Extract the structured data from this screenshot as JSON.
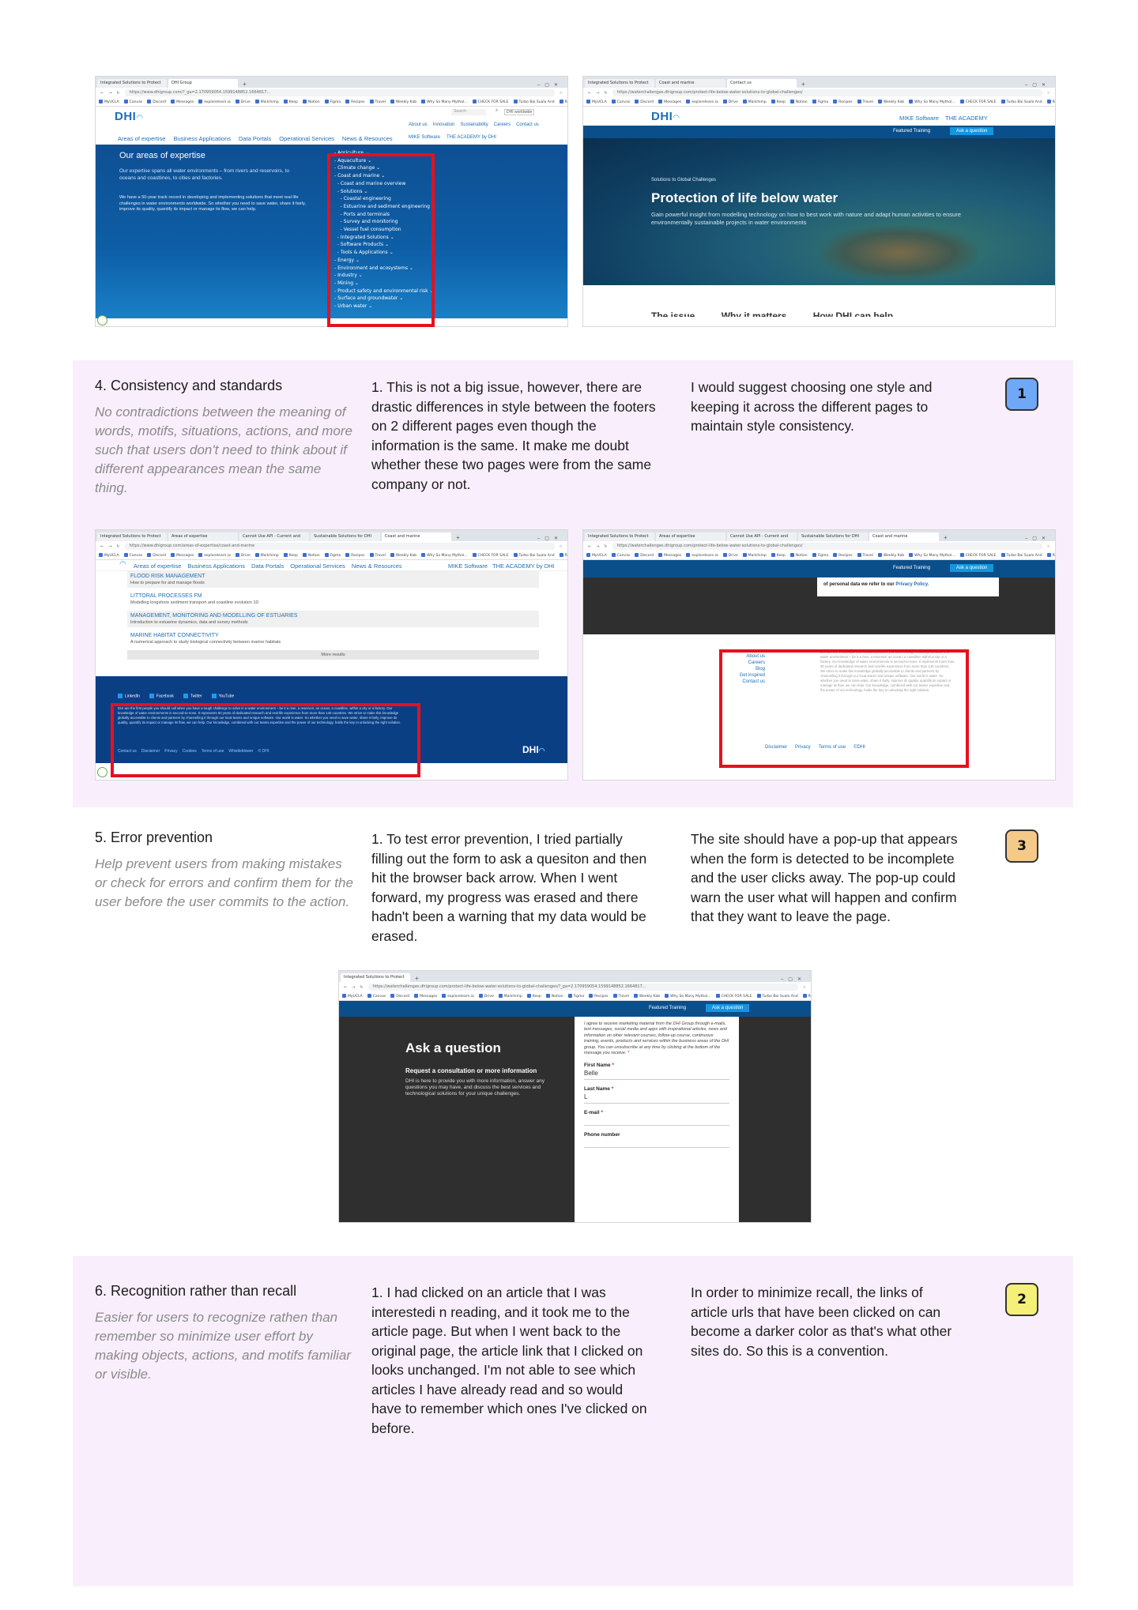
{
  "screenshot1": {
    "tabs": [
      "Integrated Solutions to Protect",
      "DHI Group"
    ],
    "url": "https://www.dhigroup.com/?_ga=2.170959054.1599148852.1664817...",
    "logo": "DHI",
    "top_links": [
      "About us",
      "Innovation",
      "Sustainability",
      "Careers",
      "Contact us"
    ],
    "search_placeholder": "Search",
    "search_badge": "DHI worldwide",
    "nav": [
      "Areas of expertise",
      "Business Applications",
      "Data Portals",
      "Operational Services",
      "News & Resources"
    ],
    "nav_right": [
      "MIKE Software",
      "THE ACADEMY by DHI"
    ],
    "hero_title": "Our areas of expertise",
    "hero_text_1": "Our expertise spans all water environments – from rivers and reservoirs, to oceans and coastlines, to cities and factories.",
    "hero_text_2": "We have a 50-year track record in developing and implementing solutions that meet real life challenges in water environments worldwide. So whether you need to save water, share it fairly, improve its quality, quantify its impact or manage its flow, we can help.",
    "menu": [
      "- Agriculture ⌄",
      "- Aquaculture ⌄",
      "- Climate change ⌄",
      "- Coast and marine ⌄",
      "  - Coast and marine overview",
      "  - Solutions ⌄",
      "    - Coastal engineering",
      "    - Estuarine and sediment engineering",
      "    - Ports and terminals",
      "    - Survey and monitoring",
      "    - Vessel fuel consumption",
      "  - Integrated Solutions ⌄",
      "  - Software Products ⌄",
      "  - Tools & Applications ⌄",
      "- Energy ⌄",
      "- Environment and ecosystems ⌄",
      "- Industry ⌄",
      "- Mining ⌄",
      "- Product safety and environmental risk ⌄",
      "- Surface and groundwater ⌄",
      "- Urban water ⌄"
    ]
  },
  "screenshot2": {
    "tabs": [
      "Integrated Solutions to Protect",
      "Coast and marine",
      "Contact us"
    ],
    "url": "https://waterchallenges.dhigroup.com/protect-life-below-water-solutions-to-global-challenges/",
    "logo": "DHI",
    "nav_right": [
      "MIKE Software",
      "THE ACADEMY"
    ],
    "featured": "Featured Training",
    "ask": "Ask a question",
    "eyebrow": "Solutions to Global Challenges",
    "title": "Protection of life below water",
    "subtitle": "Gain powerful insight from modelling technology on how to best work with nature and adapt human activities to ensure environmentally sustainable projects in water environments",
    "bottom_cut": "The issue          Why it matters          How DHI can help"
  },
  "bookmarks": [
    "MyUCLA",
    "Canvas",
    "Discord",
    "Messages",
    "explorelearn.ia",
    "Drive",
    "Mailchimp",
    "Keep",
    "Notion",
    "Figma",
    "Recipes",
    "Travel",
    "Weekly Kab",
    "Why So Many Mythol...",
    "CHECK FOR SALE",
    "Turbo Bai Sualo And",
    "Roque"
  ],
  "section4": {
    "heading": "4. Consistency and standards",
    "description": "No contradictions between the meaning of words, motifs, situations, actions, and more such that users don't need to think about if different appearances mean the same thing.",
    "issue": "1. This is not a big issue, however, there are drastic differences in style between the footers on 2 different pages even though the information is the same. It make me doubt whether these two pages were from the same company or not.",
    "suggestion": "I would suggest choosing one style and keeping it across the different pages to maintain style consistency.",
    "severity": "1",
    "severity_color": "#6ea8f7"
  },
  "screenshot3": {
    "tabs": [
      "Integrated Solutions to Protect",
      "Areas of expertise",
      "Cannot Use API - Current and",
      "Sustainable Solutions for DHI",
      "Coast and marine"
    ],
    "url": "https://www.dhigroup.com/areas-of-expertise/coast-and-marine",
    "nav": [
      "Areas of expertise",
      "Business Applications",
      "Data Portals",
      "Operational Services",
      "News & Resources"
    ],
    "nav_right": [
      "MIKE Software",
      "THE ACADEMY by DHI"
    ],
    "list": [
      {
        "title": "FLOOD RISK MANAGEMENT",
        "desc": "How to prepare for and manage floods"
      },
      {
        "title": "LITTORAL PROCESSES FM",
        "desc": "Modelling longshore sediment transport and coastline evolution 1D"
      },
      {
        "title": "MANAGEMENT, MONITORING AND MODELLING OF ESTUARIES",
        "desc": "Introduction to estuarine dynamics, data and survey methods"
      },
      {
        "title": "MARINE HABITAT CONNECTIVITY",
        "desc": "A numerical approach to study biological connectivity between marine habitats"
      }
    ],
    "more": "More results",
    "social": [
      "LinkedIn",
      "Facebook",
      "Twitter",
      "YouTube"
    ],
    "footer_text": "DHI are the first people you should call when you have a tough challenge to solve in a water environment – be it a river, a reservoir, an ocean, a coastline, within a city or a factory. Our knowledge of water environments is second-to-none. It represents 50 years of dedicated research and real-life experience from more than 140 countries. We strive to make this knowledge globally accessible to clients and partners by channelling it through our local teams and unique software. Our world is water. So whether you need to save water, share it fairly, improve its quality, quantify its impact or manage its flow, we can help. Our knowledge, combined with our teams expertise and the power of our technology, holds the key to unlocking the right solution.",
    "footer_links": [
      "Contact us",
      "Disclaimer",
      "Privacy",
      "Cookies",
      "Terms of use",
      "Whistleblower",
      "© DHI"
    ],
    "logo": "DHI"
  },
  "screenshot4": {
    "tabs": [
      "Integrated Solutions to Protect",
      "Areas of expertise",
      "Cannot Use API - Current and",
      "Sustainable Solutions for DHI",
      "Coast and marine"
    ],
    "url": "https://waterchallenges.dhigroup.com/protect-life-below-water-solutions-to-global-challenges/",
    "featured": "Featured Training",
    "ask": "Ask a question",
    "privacy_text": "of personal data we refer to our",
    "privacy_link": "Privacy Policy.",
    "links": [
      "About us",
      "Careers",
      "Blog",
      "Get inspired",
      "Contact us"
    ],
    "footer_text": "DHI are the first people you should call when you have a tough challenge to solve in a water environment – be it a river, a reservoir, an ocean, a coastline, within a city or a factory. Our knowledge of water environments is second-to-none. It represents more than 50 years of dedicated research and real-life experience from more than 140 countries. We strive to make this knowledge globally accessible to clients and partners by channelling it through our local teams and unique software. Our world is water. So whether you need to save water, share it fairly, improve its quality, quantify its impact or manage its flow, we can help. Our knowledge, combined with our teams expertise and the power of our technology, holds the key to unlocking the right solution.",
    "bottom_links": [
      "Disclaimer",
      "Privacy",
      "Terms of use",
      "©DHI"
    ]
  },
  "section5": {
    "heading": "5. Error prevention",
    "description": "Help prevent users from making mistakes or check for errors and confirm them for the user before the user commits to the action.",
    "issue": "1. To test error prevention, I tried partially filling out the form to ask a quesiton and then hit the browser back arrow. When I went forward, my progress was erased and there hadn't been a warning that my data would be erased.",
    "suggestion": "The site should have a pop-up that appears when the form is detected to be incomplete and the user clicks away. The pop-up could warn the user what will happen and confirm that they want to leave the page.",
    "severity": "3",
    "severity_color": "#f5c98a"
  },
  "screenshot5": {
    "tabs": [
      "Integrated Solutions to Protect"
    ],
    "url": "https://waterchallenges.dhigroup.com/protect-life-below-water-solutions-to-global-challenges/?_ga=2.170959054.1599148852.1664817...",
    "featured": "Featured Training",
    "ask": "Ask a question",
    "form_title": "Ask a question",
    "form_subtitle": "Request a consultation or more information",
    "form_text": "DHI is here to provide you with more information, answer any questions you may have, and discuss the best services and technological solutions for your unique challenges.",
    "consent": "I agree to receive marketing material from the DHI Group through e-mails, text messages, social media and apps with inspirational articles, news and information on other relevant courses, follow-up course, continuous training, events, products and services within the business areas of the DHI group. You can unsubscribe at any time by clicking at the bottom of the message you receive.",
    "fields": [
      {
        "label": "First Name",
        "required": true,
        "value": "Belle"
      },
      {
        "label": "Last Name",
        "required": true,
        "value": "L"
      },
      {
        "label": "E-mail",
        "required": true,
        "value": ""
      },
      {
        "label": "Phone number",
        "required": false,
        "value": ""
      }
    ]
  },
  "section6": {
    "heading": "6. Recognition rather than recall",
    "description": "Easier for users to recognize rathen than remember so minimize user effort by making objects, actions, and motifs familiar or visible.",
    "issue": "1. I had clicked on an article that I was interestedi n reading, and it took me to the article page. But when I went back to the original page, the article link that I clicked on looks unchanged. I'm not able to see which articles I have already read and so would have to remember which ones I've clicked on before.",
    "suggestion": "In order to minimize recall, the links of article urls that have been clicked on can become a darker color as that's what other sites do. So this is a convention.",
    "severity": "2",
    "severity_color": "#f4f078"
  }
}
